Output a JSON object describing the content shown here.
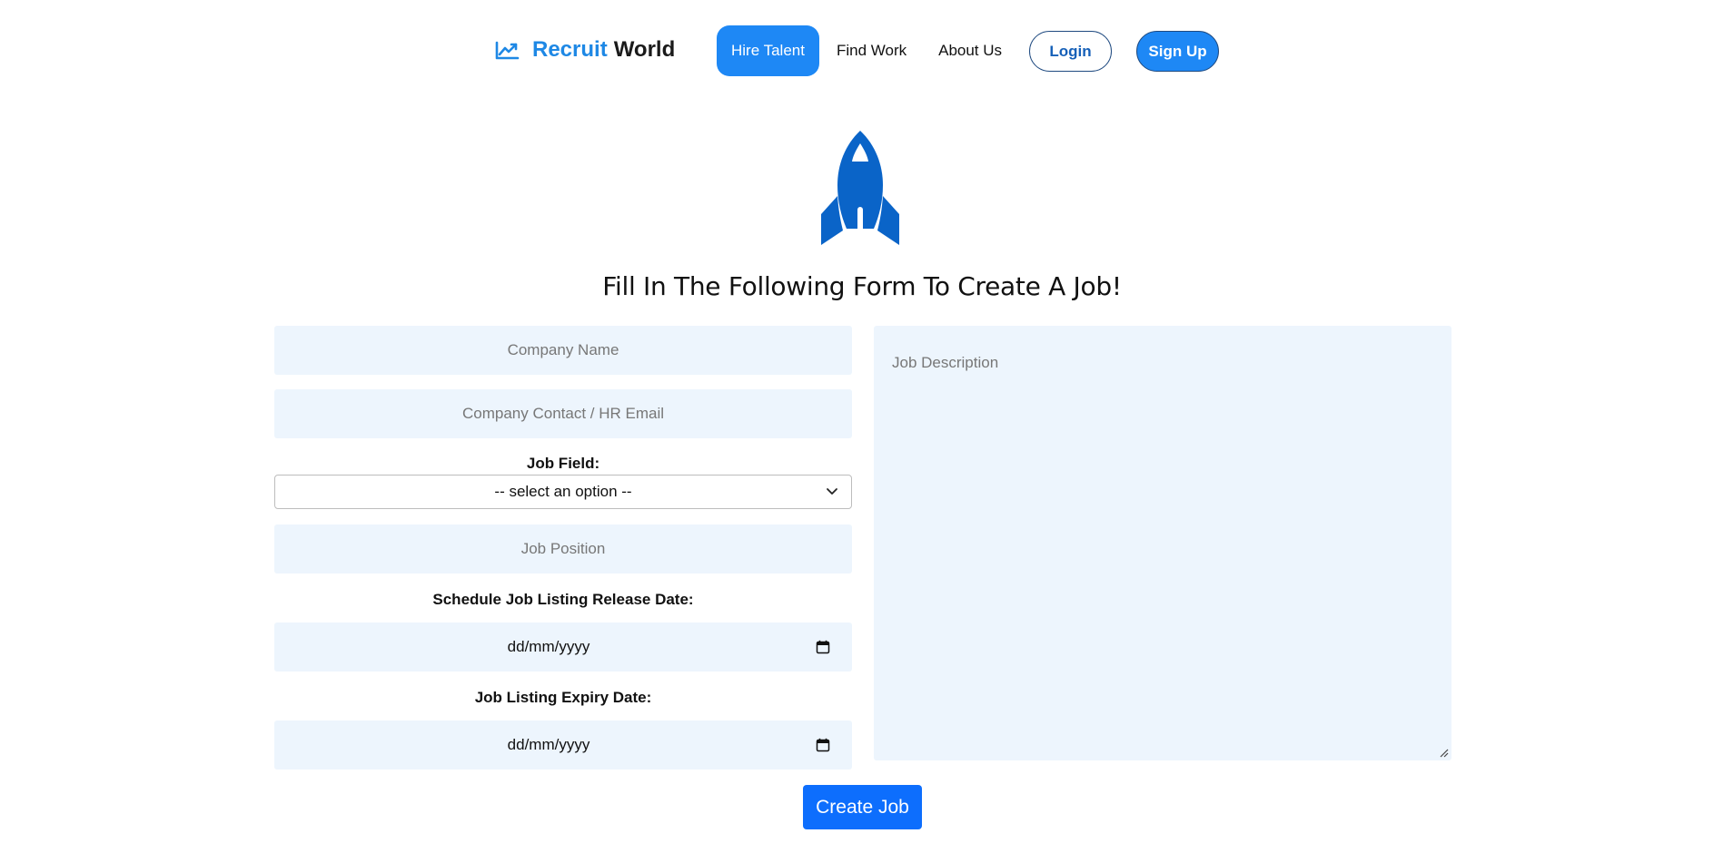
{
  "colors": {
    "accent": "#1e88f5",
    "brand_blue": "#1e88e5",
    "rocket_blue": "#0a64c8",
    "field_bg": "#edf5fd",
    "create_button": "#0d6efd"
  },
  "header": {
    "brand": {
      "icon": "trending-up-icon",
      "first": "Recruit",
      "second": "World"
    },
    "nav": [
      {
        "label": "Hire Talent",
        "active": true
      },
      {
        "label": "Find Work",
        "active": false
      },
      {
        "label": "About Us",
        "active": false
      }
    ],
    "login_label": "Login",
    "signup_label": "Sign Up"
  },
  "hero": {
    "icon": "rocket-icon",
    "title": "Fill In The Following Form To Create A Job!"
  },
  "form": {
    "company_name_placeholder": "Company Name",
    "email_placeholder": "Company Contact / HR Email",
    "job_field_label": "Job Field:",
    "job_field_selected": "-- select an option --",
    "job_position_placeholder": "Job Position",
    "release_date_label": "Schedule Job Listing Release Date:",
    "release_date_value": "dd/mm/yyyy",
    "expiry_date_label": "Job Listing Expiry Date:",
    "expiry_date_value": "dd/mm/yyyy",
    "description_placeholder": "Job Description",
    "submit_label": "Create Job"
  }
}
